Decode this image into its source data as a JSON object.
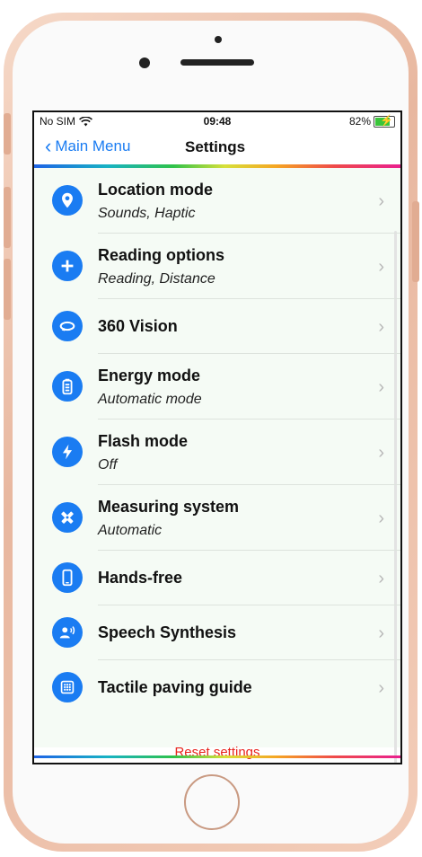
{
  "status_bar": {
    "carrier": "No SIM",
    "time": "09:48",
    "battery": "82%"
  },
  "nav": {
    "back_label": "Main Menu",
    "title": "Settings"
  },
  "items": [
    {
      "title": "Location mode",
      "subtitle": "Sounds, Haptic",
      "icon": "location-pin-icon"
    },
    {
      "title": "Reading options",
      "subtitle": "Reading, Distance",
      "icon": "plus-circle-icon"
    },
    {
      "title": "360 Vision",
      "subtitle": "",
      "icon": "rotate-360-icon"
    },
    {
      "title": "Energy mode",
      "subtitle": "Automatic mode",
      "icon": "battery-icon"
    },
    {
      "title": "Flash mode",
      "subtitle": "Off",
      "icon": "lightning-icon"
    },
    {
      "title": "Measuring system",
      "subtitle": "Automatic",
      "icon": "ruler-pencil-icon"
    },
    {
      "title": "Hands-free",
      "subtitle": "",
      "icon": "phone-icon"
    },
    {
      "title": "Speech Synthesis",
      "subtitle": "",
      "icon": "speaking-person-icon"
    },
    {
      "title": "Tactile paving guide",
      "subtitle": "",
      "icon": "grid-icon"
    }
  ],
  "footer": {
    "reset_label": "Reset settings"
  },
  "colors": {
    "accent": "#1a7cf2",
    "reset": "#e8251e",
    "list_bg": "#f5fbf5"
  }
}
